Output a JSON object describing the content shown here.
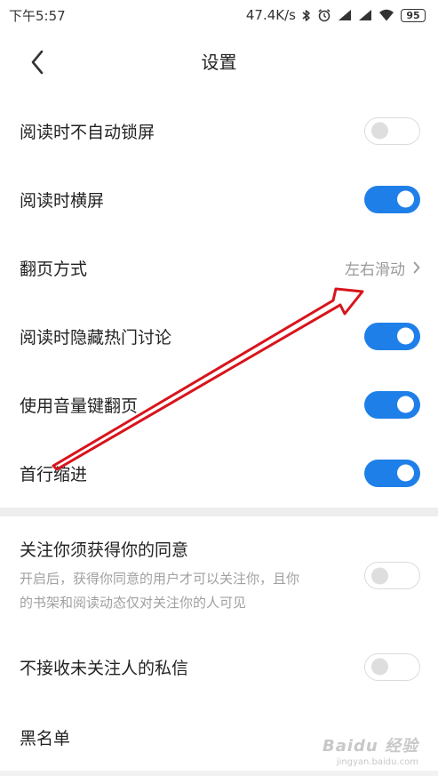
{
  "status_bar": {
    "time": "下午5:57",
    "network_speed": "47.4K/s",
    "battery": "95",
    "icons": [
      "bluetooth-icon",
      "alarm-icon",
      "signal-icon",
      "signal-icon",
      "wifi-icon",
      "battery-icon"
    ]
  },
  "header": {
    "title": "设置",
    "back_icon": "chevron-left-icon"
  },
  "settings": {
    "lock_screen": {
      "label": "阅读时不自动锁屏",
      "enabled": false
    },
    "landscape": {
      "label": "阅读时横屏",
      "enabled": true
    },
    "page_turn": {
      "label": "翻页方式",
      "value": "左右滑动"
    },
    "hide_discussion": {
      "label": "阅读时隐藏热门讨论",
      "enabled": true
    },
    "volume_keys": {
      "label": "使用音量键翻页",
      "enabled": true
    },
    "indent": {
      "label": "首行缩进",
      "enabled": true
    }
  },
  "privacy": {
    "follow_consent": {
      "label": "关注你须获得你的同意",
      "description_line1": "开启后，获得你同意的用户才可以关注你，且你",
      "description_line2": "的书架和阅读动态仅对关注你的人可见",
      "enabled": false
    },
    "block_messages": {
      "label": "不接收未关注人的私信",
      "enabled": false
    },
    "blacklist": {
      "label": "黑名单"
    }
  },
  "watermark": {
    "logo": "Baidu 经验",
    "url": "jingyan.baidu.com"
  },
  "colors": {
    "toggle_on": "#1f7fe8",
    "toggle_off_border": "#dcdcdc",
    "annotation_arrow": "#d8141c",
    "section_divider": "#eeeeee"
  }
}
